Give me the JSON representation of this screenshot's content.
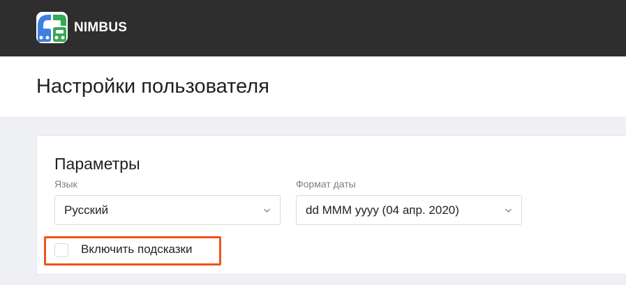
{
  "app": {
    "brand": "NIMBUS",
    "logo_icon": "nimbus-logo-icon",
    "topbar_color": "#2e2e2e"
  },
  "page": {
    "title": "Настройки пользователя"
  },
  "settings": {
    "section_title": "Параметры",
    "language": {
      "label": "Язык",
      "value": "Русский"
    },
    "date_format": {
      "label": "Формат даты",
      "value": "dd MMM yyyy (04 апр. 2020)"
    },
    "hints": {
      "label": "Включить подсказки",
      "checked": false
    },
    "highlight_color": "#f0521e"
  }
}
